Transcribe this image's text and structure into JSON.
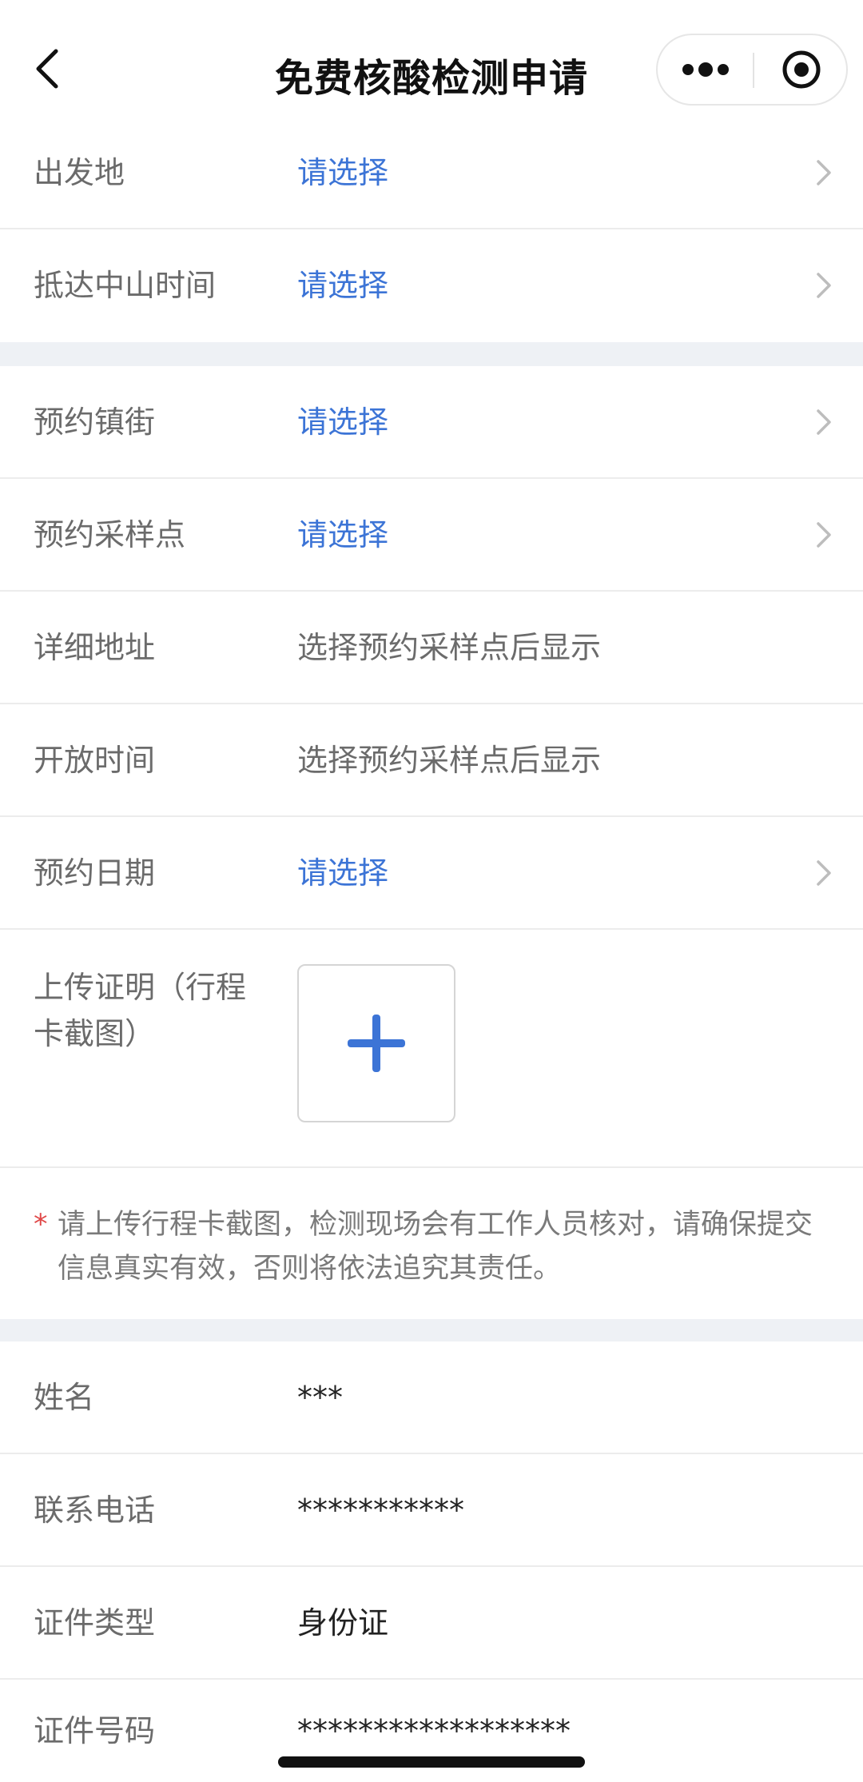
{
  "header": {
    "title": "免费核酸检测申请"
  },
  "form": {
    "departure": {
      "label": "出发地",
      "value": "请选择"
    },
    "arrival_time": {
      "label": "抵达中山时间",
      "value": "请选择"
    },
    "town": {
      "label": "预约镇街",
      "value": "请选择"
    },
    "sampling_point": {
      "label": "预约采样点",
      "value": "请选择"
    },
    "address": {
      "label": "详细地址",
      "value": "选择预约采样点后显示"
    },
    "open_hours": {
      "label": "开放时间",
      "value": "选择预约采样点后显示"
    },
    "date": {
      "label": "预约日期",
      "value": "请选择"
    },
    "upload": {
      "label": "上传证明（行程卡截图）"
    },
    "note": {
      "star": "*",
      "text": "请上传行程卡截图，检测现场会有工作人员核对，请确保提交信息真实有效，否则将依法追究其责任。"
    }
  },
  "personal": {
    "name": {
      "label": "姓名",
      "value": "***"
    },
    "phone": {
      "label": "联系电话",
      "value": "***********"
    },
    "id_type": {
      "label": "证件类型",
      "value": "身份证"
    },
    "id_number": {
      "label": "证件号码",
      "value": "******************"
    }
  },
  "colors": {
    "link": "#3c74d6",
    "accent_plus": "#3c74d6",
    "required_star": "#e04848",
    "section_gap": "#eef1f5"
  },
  "icons": {
    "back": "chevron-left-icon",
    "more": "more-dots-icon",
    "close": "target-circle-icon",
    "row_arrow": "chevron-right-icon",
    "upload": "plus-icon"
  }
}
